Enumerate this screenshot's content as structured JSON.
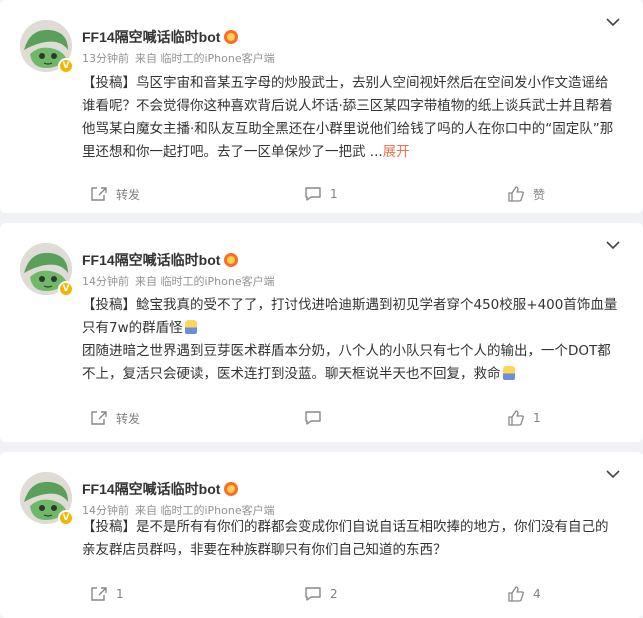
{
  "posts": [
    {
      "author": "FF14隔空喊话临时bot",
      "time": "13分钟前",
      "source": "来自 临时工的iPhone客户端",
      "text": "【投稿】鸟区宇宙和音某五字母的炒股武士，去别人空间视奸然后在空间发小作文造谣给谁看呢？不会觉得你这种喜欢背后说人坏话·舔三区某四字带植物的纸上谈兵武士并且帮着他骂某白魔女主播·和队友互助全黑还在小群里说他们给钱了吗的人在你口中的“固定队”那里还想和你一起打吧。去了一区单保炒了一把武 ...",
      "expand": "展开",
      "share_label": "转发",
      "comment_count": "1",
      "like_label": "赞"
    },
    {
      "author": "FF14隔空喊话临时bot",
      "time": "14分钟前",
      "source": "来自 临时工的iPhone客户端",
      "text_line1": "【投稿】鲶宝我真的受不了了，打讨伐进哈迪斯遇到初见学者穿个450校服+400首饰血量只有7w的群盾怪",
      "text_line2": "团随进暗之世界遇到豆芽医术群盾本分奶，八个人的小队只有七个人的输出，一个DOT都不上，复活只会硬读，医术连打到没蓝。聊天框说半天也不回复，救命",
      "share_label": "转发",
      "comment_count": "",
      "like_count": "1"
    },
    {
      "author": "FF14隔空喊话临时bot",
      "time": "14分钟前",
      "source": "来自 临时工的iPhone客户端",
      "text": "【投稿】是不是所有有你们的群都会变成你们自说自话互相吹捧的地方，你们没有自己的亲友群店员群吗，非要在种族群聊只有你们自己知道的东西？",
      "share_label": "1",
      "comment_count": "2",
      "like_count": "4"
    }
  ],
  "colors": {
    "expand": "#eb7350",
    "meta": "#939393",
    "action": "#808080"
  },
  "icons": [
    "avatar-frog-icon",
    "verified-badge-icon",
    "vip-crown-icon",
    "chevron-down-icon",
    "share-icon",
    "comment-icon",
    "like-icon"
  ]
}
